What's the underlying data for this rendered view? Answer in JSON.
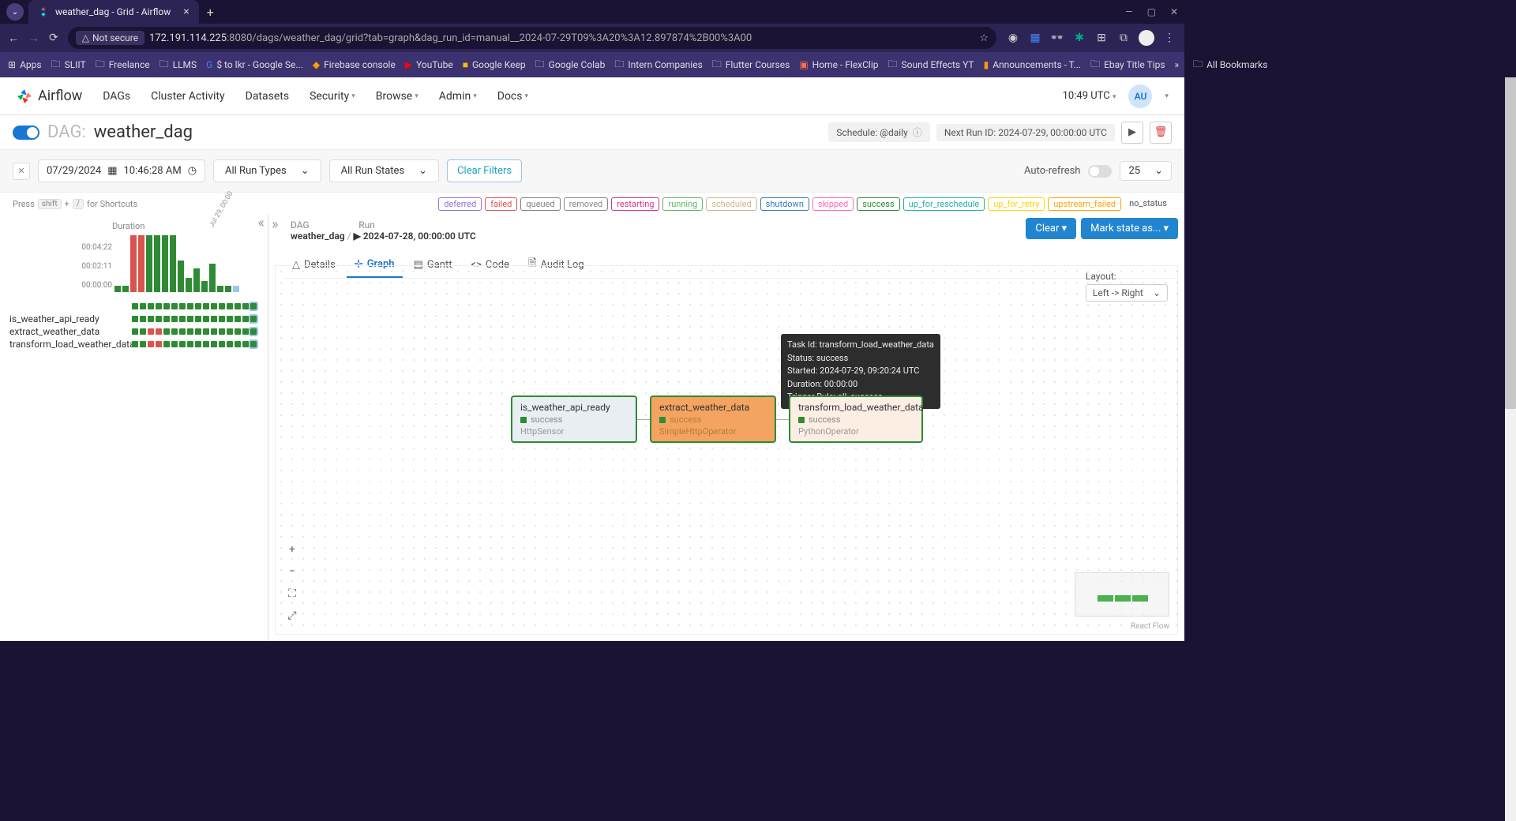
{
  "browser": {
    "tab_title": "weather_dag - Grid - Airflow",
    "url_host": "172.191.114.225",
    "url_path": ":8080/dags/weather_dag/grid?tab=graph&dag_run_id=manual__2024-07-29T09%3A20%3A12.897874%2B00%3A00",
    "not_secure": "Not secure",
    "bookmarks": [
      "Apps",
      "SLIIT",
      "Freelance",
      "LLMS",
      "$ to lkr - Google Se...",
      "Firebase console",
      "YouTube",
      "Google Keep",
      "Google Colab",
      "Intern Companies",
      "Flutter Courses",
      "Home - FlexClip",
      "Sound Effects YT",
      "Announcements - T...",
      "Ebay Title Tips"
    ],
    "all_bookmarks": "All Bookmarks"
  },
  "header": {
    "logo": "Airflow",
    "nav": [
      "DAGs",
      "Cluster Activity",
      "Datasets",
      "Security",
      "Browse",
      "Admin",
      "Docs"
    ],
    "time": "10:49 UTC",
    "user": "AU"
  },
  "dag": {
    "label": "DAG:",
    "name": "weather_dag",
    "schedule": "Schedule: @daily",
    "next_run": "Next Run ID: 2024-07-29, 00:00:00 UTC"
  },
  "filters": {
    "date": "07/29/2024",
    "time": "10:46:28 AM",
    "run_types": "All Run Types",
    "run_states": "All Run States",
    "clear": "Clear Filters",
    "auto_refresh": "Auto-refresh",
    "limit": "25"
  },
  "shortcuts": {
    "press": "Press",
    "shift": "shift",
    "plus": "+",
    "slash": "/",
    "rest": "for Shortcuts"
  },
  "legend": {
    "items": [
      {
        "label": "deferred",
        "color": "#9370db"
      },
      {
        "label": "failed",
        "color": "#d9534f"
      },
      {
        "label": "queued",
        "color": "#808080"
      },
      {
        "label": "removed",
        "color": "#888"
      },
      {
        "label": "restarting",
        "color": "#d63384"
      },
      {
        "label": "running",
        "color": "#5cb85c"
      },
      {
        "label": "scheduled",
        "color": "#d2b48c"
      },
      {
        "label": "shutdown",
        "color": "#337ab7"
      },
      {
        "label": "skipped",
        "color": "#ff69b4"
      },
      {
        "label": "success",
        "color": "#2e8b34"
      },
      {
        "label": "up_for_reschedule",
        "color": "#20b2aa"
      },
      {
        "label": "up_for_retry",
        "color": "#ffd700"
      },
      {
        "label": "upstream_failed",
        "color": "#ffa500"
      }
    ],
    "no_status": "no_status"
  },
  "grid": {
    "duration_lbl": "Duration",
    "date_lbl": "Jul 29, 00:00",
    "y_ticks": [
      "00:04:22",
      "00:02:11",
      "00:00:00"
    ],
    "tasks": [
      "is_weather_api_ready",
      "extract_weather_data",
      "transform_load_weather_data"
    ]
  },
  "detail": {
    "dag_crumb": "DAG",
    "dag_name": "weather_dag",
    "run_crumb": "Run",
    "run_val": "2024-07-28, 00:00:00 UTC",
    "clear_btn": "Clear ▾",
    "mark_btn": "Mark state as... ▾",
    "tabs": [
      "Details",
      "Graph",
      "Gantt",
      "Code",
      "Audit Log"
    ],
    "layout_lbl": "Layout:",
    "layout_val": "Left -> Right"
  },
  "tooltip": {
    "task": "Task Id: transform_load_weather_data",
    "status": "Status: success",
    "started": "Started: 2024-07-29, 09:20:24 UTC",
    "duration": "Duration: 00:00:00",
    "trigger": "Trigger Rule: all_success"
  },
  "nodes": [
    {
      "title": "is_weather_api_ready",
      "status": "success",
      "op": "HttpSensor",
      "bg": "#e8eef2",
      "opcolor": "#999"
    },
    {
      "title": "extract_weather_data",
      "status": "success",
      "op": "SimpleHttpOperator",
      "bg": "#f4a460",
      "opcolor": "#b97a3a"
    },
    {
      "title": "transform_load_weather_data",
      "status": "success",
      "op": "PythonOperator",
      "bg": "#fdeee4",
      "opcolor": "#999"
    }
  ],
  "react_flow": "React Flow"
}
